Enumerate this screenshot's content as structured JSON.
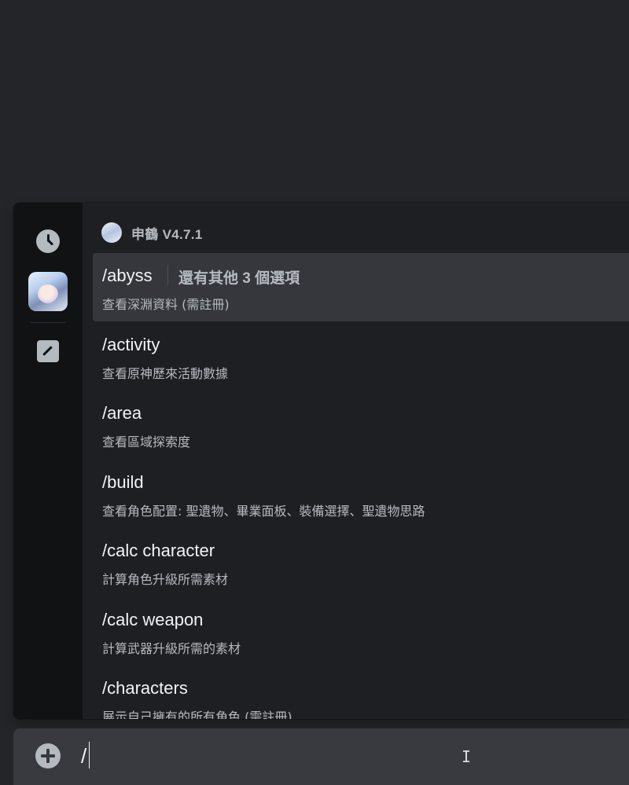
{
  "popup": {
    "bot_name": "申鶴 V4.7.1",
    "commands": [
      {
        "name": "/abyss",
        "more": "還有其他 3 個選項",
        "desc": "查看深淵資料 (需註冊)",
        "selected": true
      },
      {
        "name": "/activity",
        "desc": "查看原神歷來活動數據"
      },
      {
        "name": "/area",
        "desc": "查看區域探索度"
      },
      {
        "name": "/build",
        "desc": "查看角色配置: 聖遺物、畢業面板、裝備選擇、聖遺物思路"
      },
      {
        "name": "/calc character",
        "desc": "計算角色升級所需素材"
      },
      {
        "name": "/calc weapon",
        "desc": "計算武器升級所需的素材"
      },
      {
        "name": "/characters",
        "desc": "展示自己擁有的所有角色 (需註冊)"
      }
    ]
  },
  "rail": {
    "icons": [
      "clock-icon",
      "bot-avatar",
      "edit-icon"
    ]
  },
  "chat": {
    "input_value": "/",
    "plus_icon": "plus-circle-icon"
  },
  "colors": {
    "background": "#232529",
    "popup": "#1e1f22",
    "rail": "#111214",
    "selected": "#35373c",
    "chatbar": "#383a40"
  }
}
